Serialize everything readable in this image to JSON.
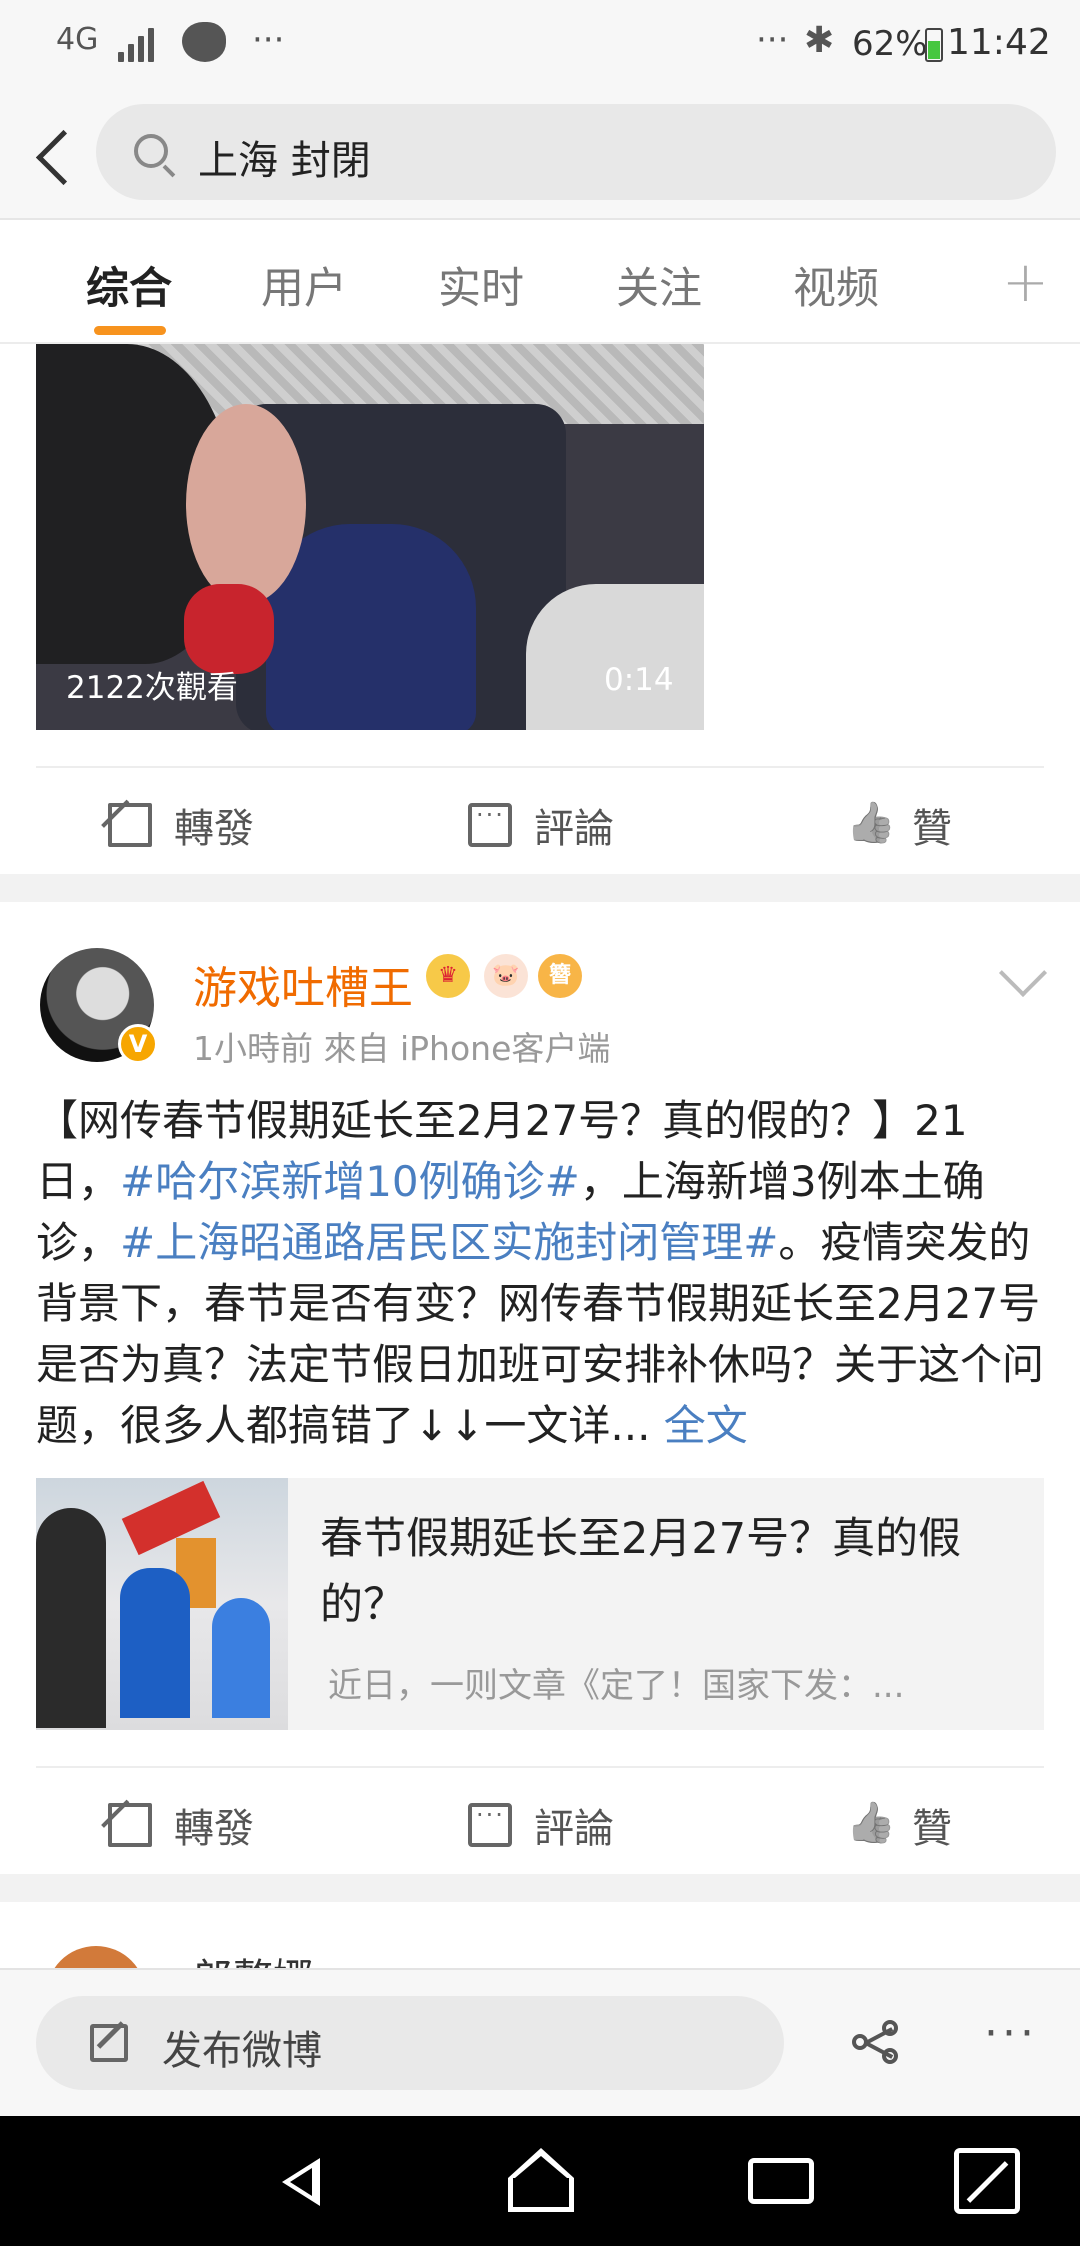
{
  "status_bar": {
    "network": "4G",
    "dots_left": "···",
    "dots_right": "···",
    "bluetooth": "✱",
    "battery": "62%",
    "time": "11:42"
  },
  "search": {
    "back_icon": "chevron-left-icon",
    "query": "上海 封閉"
  },
  "tabs": [
    "综合",
    "用户",
    "实时",
    "关注",
    "视频"
  ],
  "tabs_active": "综合",
  "tabs_plus": "+",
  "video": {
    "views": "2122次觀看",
    "duration": "0:14"
  },
  "actions": {
    "repost": "轉發",
    "comment": "評論",
    "like": "贊"
  },
  "post": {
    "username": "游戏吐槽王",
    "verified": "V",
    "badges": [
      "crown-icon",
      "pig-icon",
      "medal-icon"
    ],
    "badge3_text": "簪",
    "meta": "1小時前  來自 iPhone客户端",
    "text_1": "【网传春节假期延长至2月27号？真的假的？】21日，",
    "tag_1": "#哈尔滨新增10例确诊#",
    "text_2": "，上海新增3例本土确诊，",
    "tag_2": "#上海昭通路居民区实施封闭管理#",
    "text_3": "。疫情突发的背景下，春节是否有变？网传春节假期延长至2月27号是否为真？法定节假日加班可安排补休吗？关于这个问题，很多人都搞错了↓↓一文详...",
    "more": "全文",
    "card": {
      "title": "春节假期延长至2月27号？真的假的？",
      "summary": "近日，一则文章《定了！国家下发：..."
    }
  },
  "next_post": {
    "username": "郎整娜"
  },
  "compose": {
    "label": "发布微博",
    "more": "···"
  },
  "colors": {
    "accent_orange": "#f7931e",
    "username_orange": "#f06b00",
    "link_blue": "#4a7fc1"
  }
}
